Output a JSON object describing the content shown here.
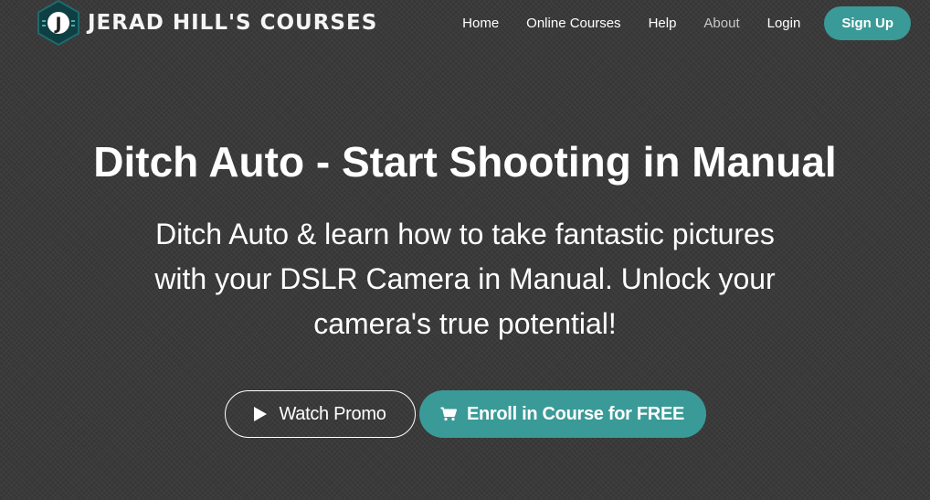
{
  "header": {
    "logo_letter": "J",
    "brand_name": "Jerad Hill's Courses",
    "nav": {
      "home": "Home",
      "online_courses": "Online Courses",
      "help": "Help",
      "about": "About",
      "login": "Login",
      "signup": "Sign Up"
    }
  },
  "hero": {
    "title": "Ditch Auto - Start Shooting in Manual",
    "subtitle": "Ditch Auto & learn how to take fantastic pictures with your DSLR Camera in Manual. Unlock your camera's true potential!"
  },
  "cta": {
    "promo_label": "Watch Promo",
    "promo_icon": "play-icon",
    "enroll_label": "Enroll in Course for FREE",
    "enroll_icon": "shopping-cart-icon"
  },
  "colors": {
    "accent": "#3a9a97",
    "background": "#3a3a3a",
    "logo_hex": "#0f3f43",
    "logo_letter_bg": "#ffffff"
  }
}
